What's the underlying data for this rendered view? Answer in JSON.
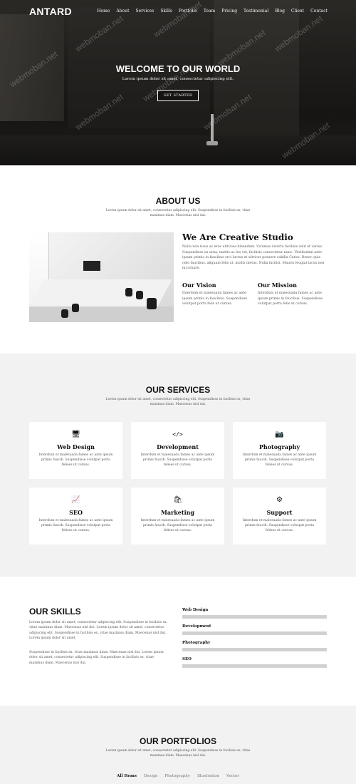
{
  "nav": {
    "logo": "ANTARD",
    "items": [
      "Home",
      "About",
      "Services",
      "Skills",
      "Portfolio",
      "Team",
      "Pricing",
      "Testimonial",
      "Blog",
      "Client",
      "Contact"
    ]
  },
  "hero": {
    "title": "WELCOME TO OUR WORLD",
    "subtitle": "Lorem ipsum dolor sit amet, consectetur adipiscing elit.",
    "button": "GET STARTED"
  },
  "watermark": "webmoban.net",
  "about": {
    "title": "ABOUT US",
    "subtitle": "Lorem ipsum dolor sit amet, consectetur adipiscing elit. Suspendisse in facilisis ex, vitae maximus diam. Maecenas nisl dui.",
    "heading": "We Are Creative Studio",
    "text": "Nulla non risus ac eros ultricies bibendum. Vivamus viverra facilisis velit et varius. Suspendisse ex urna, mattis ac leo vel, facilisis consectetur nunc. Vestibulum ante ipsum primis in faucibus orci luctus et ultrices posuere cubilia Curae. Donec quis odio faucibus, aliquam felis at, mollis metus. Nulla facilisi. Mauris feugiat lacus non mi ornare.",
    "vision_title": "Our Vision",
    "vision_text": "Interdum et malesuada fames ac ante ipsum primis in faucibus. Suspendisse volutpat porta felis ut cursus.",
    "mission_title": "Our Mission",
    "mission_text": "Interdum et malesuada fames ac ante ipsum primis in faucibus. Suspendisse volutpat porta felis ut cursus."
  },
  "services": {
    "title": "OUR SERVICES",
    "subtitle": "Lorem ipsum dolor sit amet, consectetur adipiscing elit. Suspendisse in facilisis ex, vitae maximus diam. Maecenas nisl dui.",
    "items": [
      {
        "icon": "desktop-icon",
        "glyph": "🖥",
        "title": "Web Design",
        "text": "Interdum et malesuada fames ac ante ipsum primis faucib. Suspendisse volutpat porta felises ut cursus."
      },
      {
        "icon": "code-icon",
        "glyph": "</>",
        "title": "Development",
        "text": "Interdum et malesuada fames ac ante ipsum primis faucib. Suspendisse volutpat porta felises ut cursus."
      },
      {
        "icon": "camera-icon",
        "glyph": "📷",
        "title": "Photography",
        "text": "Interdum et malesuada fames ac ante ipsum primis faucib. Suspendisse volutpat porta felises ut cursus."
      },
      {
        "icon": "chart-line-icon",
        "glyph": "📈",
        "title": "SEO",
        "text": "Interdum et malesuada fames ac ante ipsum primis faucib. Suspendisse volutpat porta felises ut cursus."
      },
      {
        "icon": "shopping-bag-icon",
        "glyph": "🛍",
        "title": "Marketing",
        "text": "Interdum et malesuada fames ac ante ipsum primis faucib. Suspendisse volutpat porta felises ut cursus."
      },
      {
        "icon": "gears-icon",
        "glyph": "⚙",
        "title": "Support",
        "text": "Interdum et malesuada fames ac ante ipsum primis faucib. Suspendisse volutpat porta felises ut cursus."
      }
    ]
  },
  "skills": {
    "title": "OUR SKILLS",
    "para1": "Lorem ipsum dolor sit amet, consectetur adipiscing elit. Suspendisse in facilisis ex, vitae maximus diam. Maecenas nisl dui. Lorem ipsum dolor sit amet, consectetur adipiscing elit. Suspendisse in facilisis ex, vitae maximus diam. Maecenas nisl dui. Lorem ipsum dolor sit amet.",
    "para2": "Suspendisse in facilisis ex, vitae maximus diam. Maecenas nisl dui. Lorem ipsum dolor sit amet, consectetur adipiscing elit. Suspendisse in facilisis ex, vitae maximus diam. Maecenas nisl dui.",
    "bars": [
      {
        "label": "Web Design",
        "level": 1.0
      },
      {
        "label": "Development",
        "level": 1.0
      },
      {
        "label": "Photography",
        "level": 1.0
      },
      {
        "label": "SEO",
        "level": 1.0
      }
    ]
  },
  "portfolio": {
    "title": "OUR PORTFOLIOS",
    "subtitle": "Lorem ipsum dolor sit amet, consectetur adipiscing elit. Suspendisse in facilisis ex, vitae maximus diam. Maecenas nisl dui.",
    "filters": [
      "All Items",
      "Design",
      "Photography",
      "Illustration",
      "Vector"
    ],
    "active_filter": "All Items"
  }
}
